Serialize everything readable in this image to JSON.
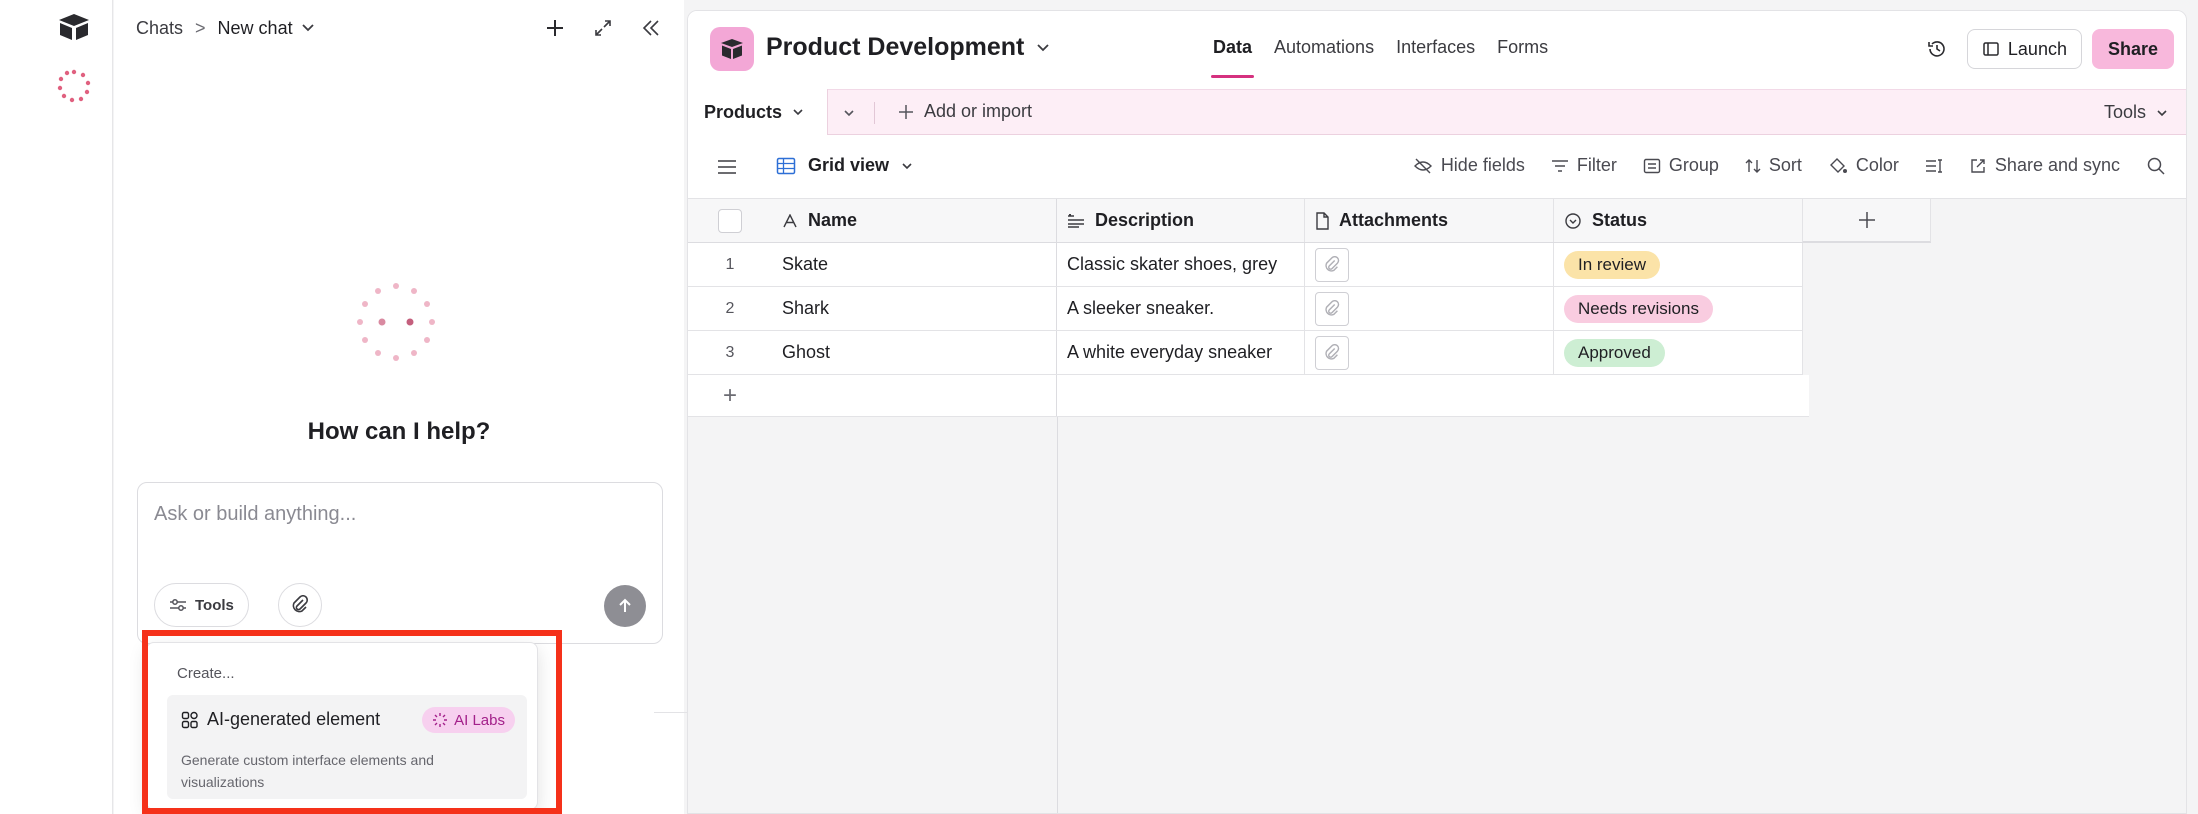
{
  "chat": {
    "breadcrumb_root": "Chats",
    "breadcrumb_current": "New chat",
    "title": "How can I help?",
    "composer_placeholder": "Ask or build anything...",
    "tools_label": "Tools"
  },
  "popup": {
    "heading": "Create...",
    "item_title": "AI-generated element",
    "item_badge": "AI Labs",
    "item_description": "Generate custom interface elements and visualizations"
  },
  "base": {
    "title": "Product Development",
    "nav": [
      "Data",
      "Automations",
      "Interfaces",
      "Forms"
    ],
    "launch_label": "Launch",
    "share_label": "Share",
    "table_tab": "Products",
    "add_import": "Add or import",
    "tools_label": "Tools",
    "view_name": "Grid view",
    "view_actions": [
      "Hide fields",
      "Filter",
      "Group",
      "Sort",
      "Color",
      "Share and sync"
    ]
  },
  "table": {
    "columns": [
      "Name",
      "Description",
      "Attachments",
      "Status"
    ],
    "rows": [
      {
        "num": "1",
        "name": "Skate",
        "description": "Classic skater shoes, grey",
        "status": "In review"
      },
      {
        "num": "2",
        "name": "Shark",
        "description": "A sleeker sneaker.",
        "status": "Needs revisions"
      },
      {
        "num": "3",
        "name": "Ghost",
        "description": "A white everyday sneaker",
        "status": "Approved"
      }
    ]
  },
  "colors": {
    "accent": "#d5317f",
    "share_bg": "#f8b8dc",
    "status_in_review": "#fbe3a8",
    "status_needs_revisions": "#f9cce0",
    "status_approved": "#cdeed3",
    "highlight_box": "#f5311a"
  }
}
